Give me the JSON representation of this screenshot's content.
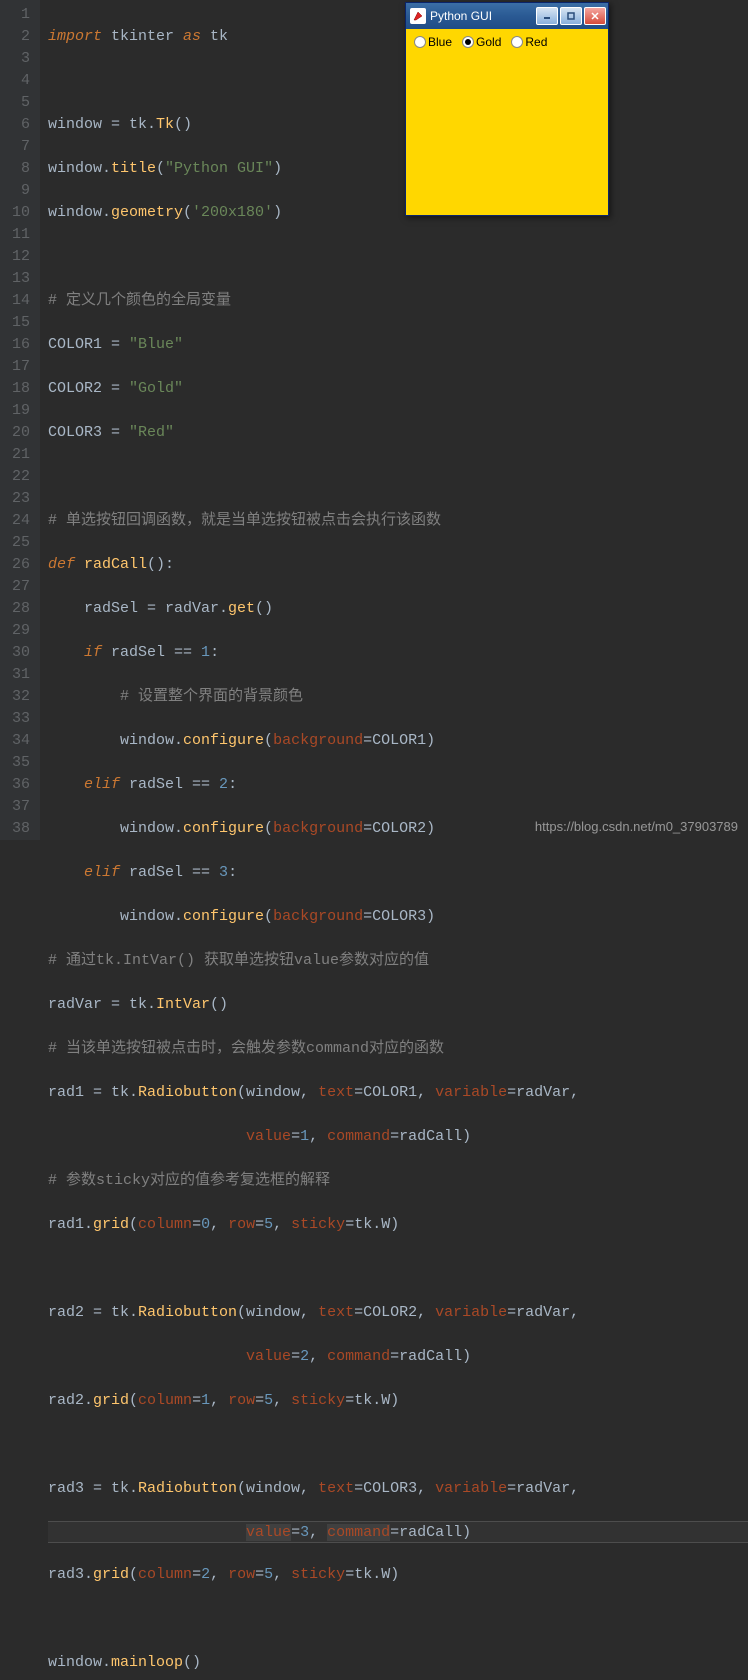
{
  "lines": [
    "1",
    "2",
    "3",
    "4",
    "5",
    "6",
    "7",
    "8",
    "9",
    "10",
    "11",
    "12",
    "13",
    "14",
    "15",
    "16",
    "17",
    "18",
    "19",
    "20",
    "21",
    "22",
    "23",
    "24",
    "25",
    "26",
    "27",
    "28",
    "29",
    "30",
    "31",
    "32",
    "33",
    "34",
    "35",
    "36",
    "37",
    "38"
  ],
  "code": {
    "l1_import": "import",
    "l1_tkinter": " tkinter ",
    "l1_as": "as",
    "l1_tk": " tk",
    "l3_window": "window = tk.",
    "l3_Tk": "Tk",
    "l3_paren": "()",
    "l4_window": "window.",
    "l4_title": "title",
    "l4_open": "(",
    "l4_str": "\"Python GUI\"",
    "l4_close": ")",
    "l5_window": "window.",
    "l5_geom": "geometry",
    "l5_open": "(",
    "l5_str": "'200x180'",
    "l5_close": ")",
    "l7_com": "# 定义几个颜色的全局变量",
    "l8_a": "COLOR1 = ",
    "l8_s": "\"Blue\"",
    "l9_a": "COLOR2 = ",
    "l9_s": "\"Gold\"",
    "l10_a": "COLOR3 = ",
    "l10_s": "\"Red\"",
    "l12_com": "# 单选按钮回调函数，就是当单选按钮被点击会执行该函数",
    "l13_def": "def",
    "l13_fn": " radCall",
    "l13_p": "():",
    "l14_a": "    radSel = radVar.",
    "l14_get": "get",
    "l14_p": "()",
    "l15_if": "    if",
    "l15_cond": " radSel == ",
    "l15_n": "1",
    "l15_c": ":",
    "l16_com": "        # 设置整个界面的背景颜色",
    "l17_w": "        window.",
    "l17_cfg": "configure",
    "l17_o": "(",
    "l17_bg": "background",
    "l17_eq": "=COLOR1)",
    "l18_elif": "    elif",
    "l18_cond": " radSel == ",
    "l18_n": "2",
    "l18_c": ":",
    "l19_w": "        window.",
    "l19_cfg": "configure",
    "l19_o": "(",
    "l19_bg": "background",
    "l19_eq": "=COLOR2)",
    "l20_elif": "    elif",
    "l20_cond": " radSel == ",
    "l20_n": "3",
    "l20_c": ":",
    "l21_w": "        window.",
    "l21_cfg": "configure",
    "l21_o": "(",
    "l21_bg": "background",
    "l21_eq": "=COLOR3)",
    "l22_com": "# 通过tk.IntVar() 获取单选按钮value参数对应的值",
    "l23_a": "radVar = tk.",
    "l23_iv": "IntVar",
    "l23_p": "()",
    "l24_com": "# 当该单选按钮被点击时，会触发参数command对应的函数",
    "l25_a": "rad1 = tk.",
    "l25_rb": "Radiobutton",
    "l25_o": "(window, ",
    "l25_text": "text",
    "l25_teq": "=COLOR1, ",
    "l25_var": "variable",
    "l25_veq": "=radVar,",
    "l26_sp": "                      ",
    "l26_val": "value",
    "l26_veq": "=",
    "l26_n": "1",
    "l26_c": ", ",
    "l26_cmd": "command",
    "l26_ceq": "=radCall)",
    "l27_com": "# 参数sticky对应的值参考复选框的解释",
    "l28_a": "rad1.",
    "l28_g": "grid",
    "l28_o": "(",
    "l28_col": "column",
    "l28_ceq": "=",
    "l28_cn": "0",
    "l28_c2": ", ",
    "l28_row": "row",
    "l28_req": "=",
    "l28_rn": "5",
    "l28_c3": ", ",
    "l28_st": "sticky",
    "l28_seq": "=tk.W)",
    "l30_a": "rad2 = tk.",
    "l30_rb": "Radiobutton",
    "l30_o": "(window, ",
    "l30_text": "text",
    "l30_teq": "=COLOR2, ",
    "l30_var": "variable",
    "l30_veq": "=radVar,",
    "l31_sp": "                      ",
    "l31_val": "value",
    "l31_veq": "=",
    "l31_n": "2",
    "l31_c": ", ",
    "l31_cmd": "command",
    "l31_ceq": "=radCall)",
    "l32_a": "rad2.",
    "l32_g": "grid",
    "l32_o": "(",
    "l32_col": "column",
    "l32_ceq": "=",
    "l32_cn": "1",
    "l32_c2": ", ",
    "l32_row": "row",
    "l32_req": "=",
    "l32_rn": "5",
    "l32_c3": ", ",
    "l32_st": "sticky",
    "l32_seq": "=tk.W)",
    "l34_a": "rad3 = tk.",
    "l34_rb": "Radiobutton",
    "l34_o": "(window, ",
    "l34_text": "text",
    "l34_teq": "=COLOR3, ",
    "l34_var": "variable",
    "l34_veq": "=radVar,",
    "l35_sp": "                      ",
    "l35_val": "value",
    "l35_veq": "=",
    "l35_n": "3",
    "l35_c": ", ",
    "l35_cmd": "command",
    "l35_ceq": "=radCall)",
    "l36_a": "rad3.",
    "l36_g": "grid",
    "l36_o": "(",
    "l36_col": "column",
    "l36_ceq": "=",
    "l36_cn": "2",
    "l36_c2": ", ",
    "l36_row": "row",
    "l36_req": "=",
    "l36_rn": "5",
    "l36_c3": ", ",
    "l36_st": "sticky",
    "l36_seq": "=tk.W)",
    "l38_a": "window.",
    "l38_ml": "mainloop",
    "l38_p": "()"
  },
  "gui": {
    "title": "Python GUI",
    "radios": {
      "blue": "Blue",
      "gold": "Gold",
      "red": "Red"
    },
    "selected": "Gold"
  },
  "watermark": "https://blog.csdn.net/m0_37903789"
}
